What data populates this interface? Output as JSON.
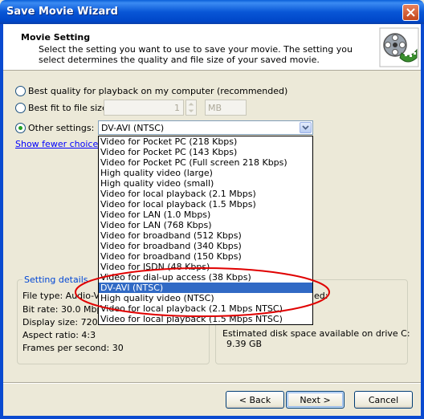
{
  "window": {
    "title": "Save Movie Wizard"
  },
  "header": {
    "title": "Movie Setting",
    "description": "Select the setting you want to use to save your movie. The setting you select determines the quality and file size of your saved movie."
  },
  "options": {
    "best_quality": "Best quality for playback on my computer (recommended)",
    "best_fit": "Best fit to file size:",
    "best_fit_value": "1",
    "best_fit_unit": "MB",
    "other": "Other settings:",
    "other_value": "DV-AVI (NTSC)",
    "selected": "other"
  },
  "link": {
    "show_fewer": "Show fewer choices..."
  },
  "dropdown": {
    "items": [
      "Video for Pocket PC (218 Kbps)",
      "Video for Pocket PC (143 Kbps)",
      "Video for Pocket PC (Full screen 218 Kbps)",
      "High quality video (large)",
      "High quality video (small)",
      "Video for local playback (2.1 Mbps)",
      "Video for local playback (1.5 Mbps)",
      "Video for LAN (1.0 Mbps)",
      "Video for LAN (768 Kbps)",
      "Video for broadband (512 Kbps)",
      "Video for broadband (340 Kbps)",
      "Video for broadband (150 Kbps)",
      "Video for ISDN (48 Kbps)",
      "Video for dial-up access (38 Kbps)",
      "DV-AVI (NTSC)",
      "High quality video (NTSC)",
      "Video for local playback (2.1 Mbps NTSC)",
      "Video for local playback (1.5 Mbps NTSC)"
    ],
    "selected_index": 14
  },
  "settings": {
    "group_title": "Setting details",
    "file_type": "File type: Audio-Vid",
    "bit_rate": "Bit rate: 30.0 Mbps",
    "display_size": "Display size: 720 x",
    "aspect_ratio": "Aspect ratio: 4:3",
    "fps": "Frames per second: 30",
    "right_partial": "ed:",
    "disk_label": "Estimated disk space available on drive C:",
    "disk_value": "9.39 GB"
  },
  "buttons": {
    "back": "< Back",
    "next": "Next >",
    "cancel": "Cancel"
  },
  "colors": {
    "title_bar": "#0856d6",
    "selection": "#316ac5",
    "annotation": "#e00000"
  }
}
